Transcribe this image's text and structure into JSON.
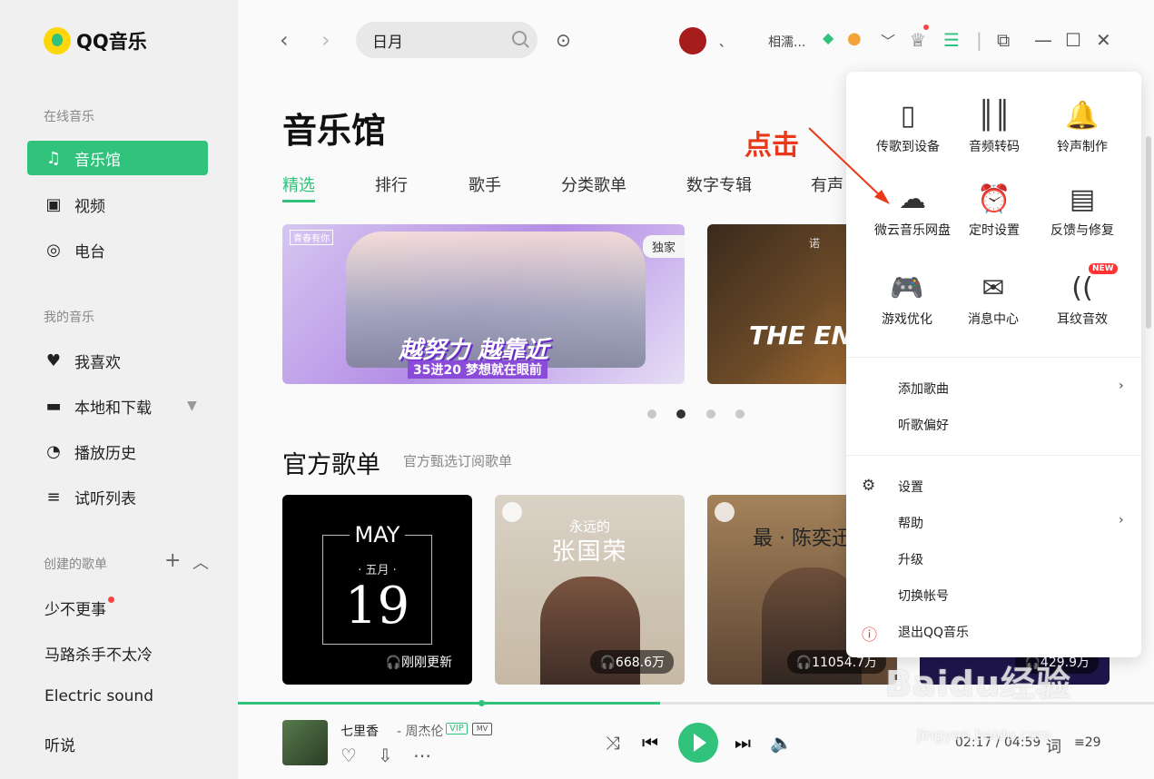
{
  "app": {
    "name": "QQ音乐"
  },
  "sidebar": {
    "online_label": "在线音乐",
    "online_items": [
      {
        "label": "音乐馆",
        "icon": "music-note-icon"
      },
      {
        "label": "视频",
        "icon": "video-icon"
      },
      {
        "label": "电台",
        "icon": "radio-icon"
      }
    ],
    "my_label": "我的音乐",
    "my_items": [
      {
        "label": "我喜欢",
        "icon": "heart-icon"
      },
      {
        "label": "本地和下载",
        "icon": "computer-icon"
      },
      {
        "label": "播放历史",
        "icon": "clock-icon"
      },
      {
        "label": "试听列表",
        "icon": "playlist-icon"
      }
    ],
    "created_label": "创建的歌单",
    "playlists": [
      "少不更事",
      "马路杀手不太冷",
      "Electric sound",
      "听说"
    ]
  },
  "topbar": {
    "search_value": "日月",
    "username": "相濡...",
    "separator": "、"
  },
  "main": {
    "title": "音乐馆",
    "tabs": [
      "精选",
      "排行",
      "歌手",
      "分类歌单",
      "数字专辑",
      "有声"
    ],
    "banner1": {
      "tag": "独家",
      "corner": "青春有你",
      "slogan": "越努力 越靠近",
      "sub": "35进20 梦想就在眼前"
    },
    "banner2": {
      "text": "THE END",
      "top": "诺"
    },
    "section_title": "官方歌单",
    "section_sub": "官方甄选订阅歌单",
    "cards": [
      {
        "month_en": "MAY",
        "month_cn": "· 五月 ·",
        "day": "19",
        "count": "刚刚更新"
      },
      {
        "line1": "永远的",
        "line2": "张国荣",
        "count": "668.6万"
      },
      {
        "line1": "最 · 陈奕迅",
        "count": "11054.7万"
      },
      {
        "count": "429.9万"
      }
    ]
  },
  "player": {
    "song": "七里香",
    "artist": "- 周杰伦",
    "vip": "VIP",
    "mv": "MV",
    "time": "02:17 / 04:59",
    "lyric": "词",
    "queue_count": "29"
  },
  "popup": {
    "grid": [
      {
        "label": "传歌到设备",
        "icon": "phone-icon"
      },
      {
        "label": "音频转码",
        "icon": "waveform-icon"
      },
      {
        "label": "铃声制作",
        "icon": "bell-icon"
      },
      {
        "label": "微云音乐网盘",
        "icon": "cloud-icon"
      },
      {
        "label": "定时设置",
        "icon": "alarm-clock-icon"
      },
      {
        "label": "反馈与修复",
        "icon": "feedback-icon"
      },
      {
        "label": "游戏优化",
        "icon": "gamepad-icon"
      },
      {
        "label": "消息中心",
        "icon": "mail-icon"
      },
      {
        "label": "耳纹音效",
        "icon": "ear-icon"
      }
    ],
    "new_badge": "NEW",
    "menu1": [
      "添加歌曲",
      "听歌偏好"
    ],
    "menu2": [
      "设置",
      "帮助",
      "升级",
      "切换帐号",
      "退出QQ音乐"
    ]
  },
  "annotation": {
    "text": "点击"
  },
  "watermark": {
    "text": "Baidu经验",
    "sub": "jingyan.baidu.com"
  },
  "colors": {
    "accent": "#31c27c",
    "annotation": "#e8391a"
  }
}
